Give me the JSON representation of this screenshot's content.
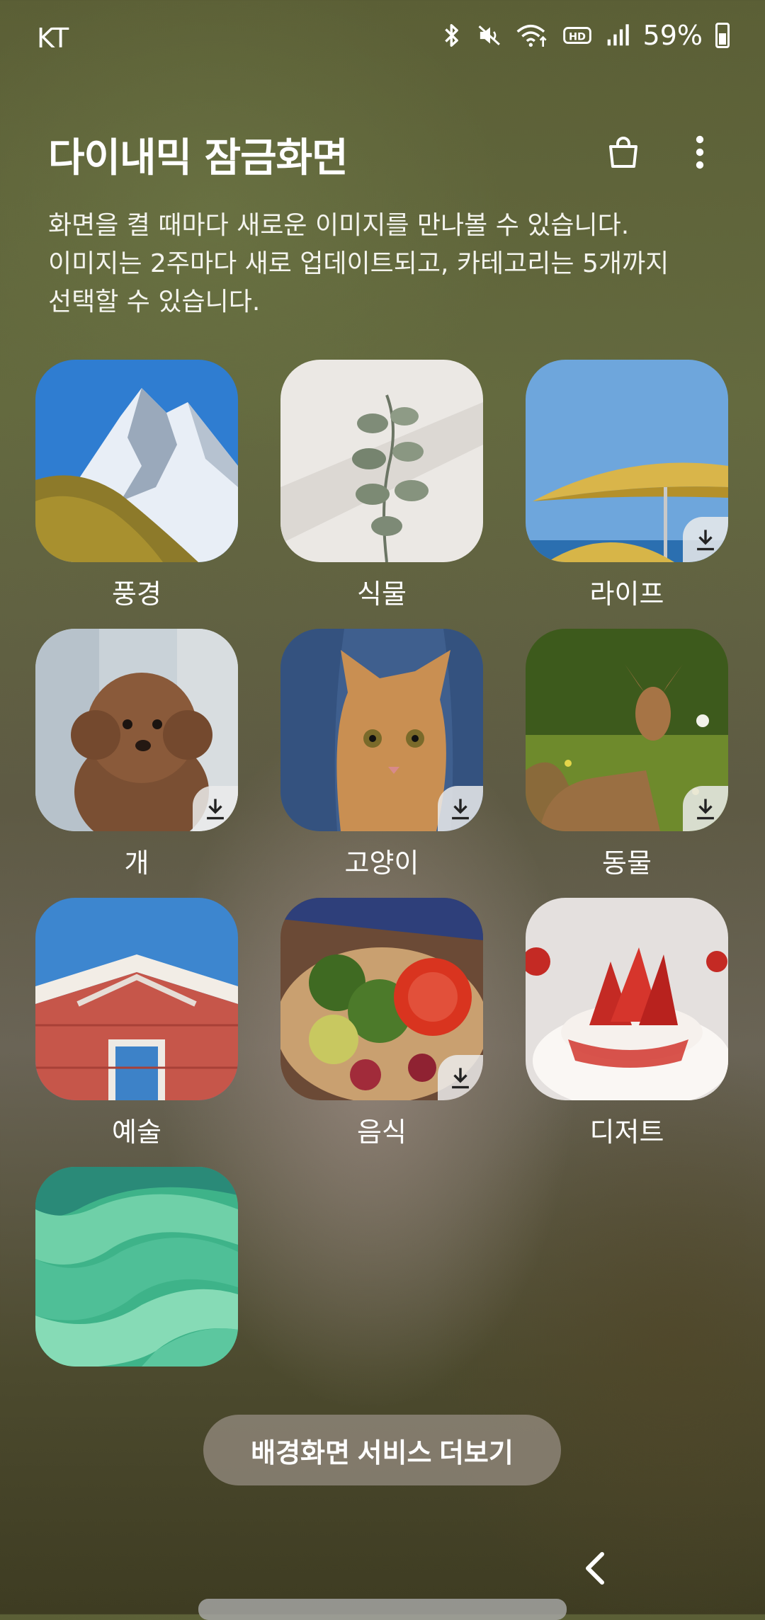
{
  "status_bar": {
    "carrier": "KT",
    "battery": "59%",
    "icons": [
      "bluetooth-icon",
      "mute-icon",
      "wifi-icon",
      "hd-voice-icon",
      "signal-icon",
      "battery-icon"
    ]
  },
  "header": {
    "title": "다이내믹 잠금화면",
    "store_icon": "shopping-bag-icon",
    "menu_icon": "more-vertical-icon"
  },
  "description": "화면을 켤 때마다 새로운 이미지를 만나볼 수 있습니다.\n이미지는 2주마다 새로 업데이트되고, 카테고리는 5개까지\n선택할 수 있습니다.",
  "categories": [
    {
      "label": "풍경",
      "download": false,
      "image": "mountain-landscape"
    },
    {
      "label": "식물",
      "download": false,
      "image": "eucalyptus-plant"
    },
    {
      "label": "라이프",
      "download": true,
      "image": "beach-umbrellas"
    },
    {
      "label": "개",
      "download": true,
      "image": "poodle-dog"
    },
    {
      "label": "고양이",
      "download": true,
      "image": "cat-in-blanket"
    },
    {
      "label": "동물",
      "download": true,
      "image": "deer-in-meadow"
    },
    {
      "label": "예술",
      "download": false,
      "image": "red-house"
    },
    {
      "label": "음식",
      "download": true,
      "image": "vegetable-dish"
    },
    {
      "label": "디저트",
      "download": false,
      "image": "strawberry-dessert"
    },
    {
      "label": "",
      "download": false,
      "image": "green-waves"
    }
  ],
  "more_button": "배경화면 서비스 더보기"
}
